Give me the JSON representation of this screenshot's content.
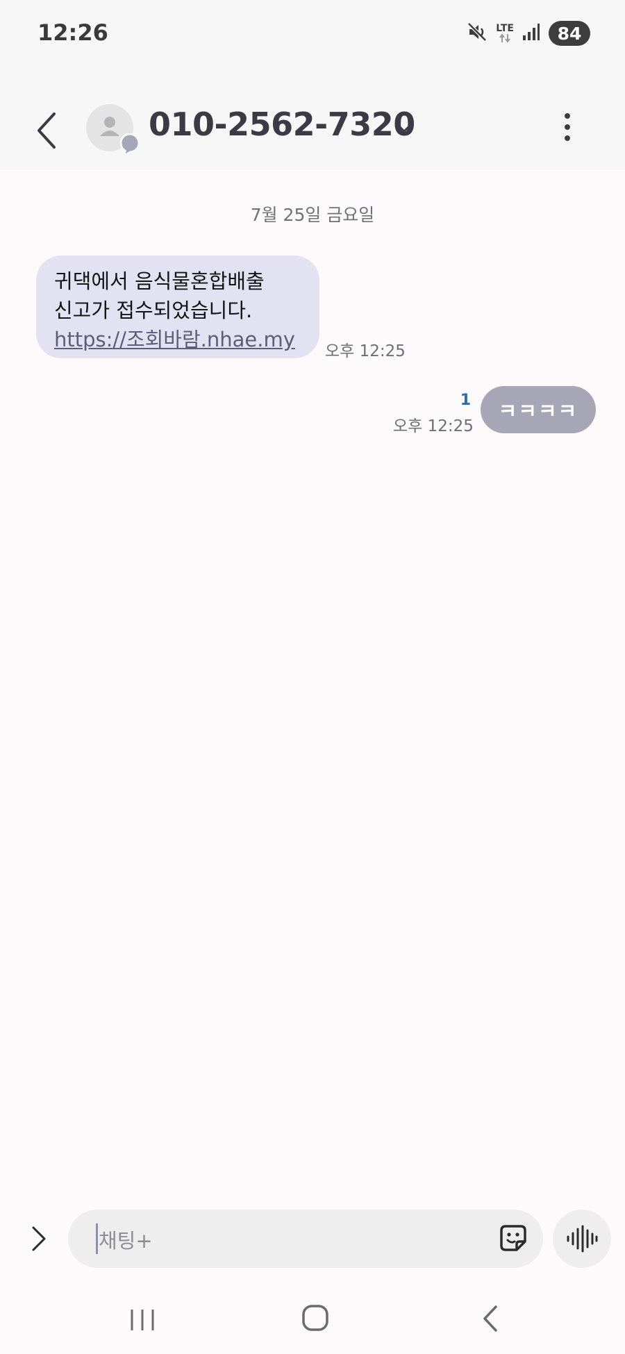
{
  "status_bar": {
    "time": "12:26",
    "network": "LTE",
    "battery": "84",
    "icons": [
      "mute-icon",
      "lte-icon",
      "signal-icon",
      "battery-icon"
    ]
  },
  "header": {
    "contact": "010-2562-7320",
    "icons": [
      "back-arrow-icon",
      "avatar-icon",
      "chat-badge-icon",
      "chevron-down-icon",
      "more-vert-icon"
    ]
  },
  "conversation": {
    "date": "7월 25일 금요일",
    "messages": [
      {
        "direction": "incoming",
        "lines": [
          "귀댁에서 음식물혼합배출",
          "신고가 접수되었습니다."
        ],
        "link": "https://조회바람.nhae.my",
        "time": "오후 12:25"
      },
      {
        "direction": "outgoing",
        "text": "ㅋㅋㅋㅋ",
        "unread": "1",
        "time": "오후 12:25"
      }
    ]
  },
  "composer": {
    "placeholder": "채팅+",
    "icons": [
      "expand-icon",
      "sticker-icon",
      "voice-icon"
    ]
  },
  "nav_bar": {
    "icons": [
      "recents-icon",
      "home-icon",
      "back-icon"
    ]
  },
  "colors": {
    "incoming_bubble": "#e2e2f2",
    "outgoing_bubble": "#a6a6b6",
    "unread": "#2c6bb0"
  }
}
